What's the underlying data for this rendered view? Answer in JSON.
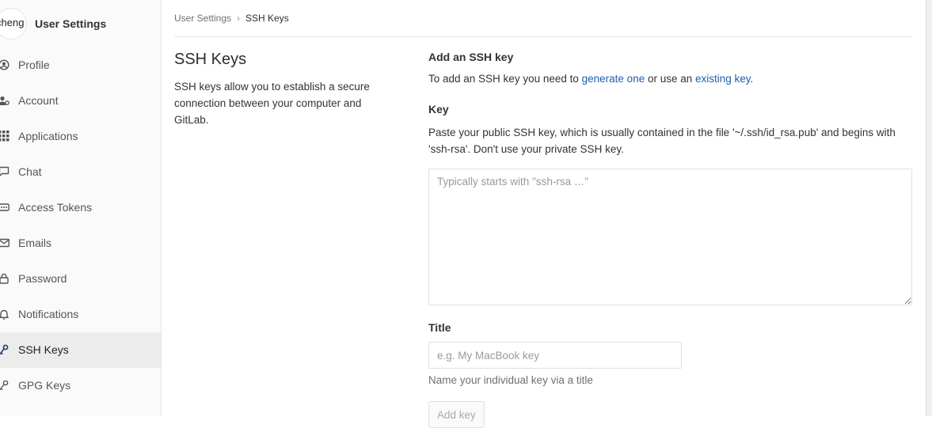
{
  "sidebar": {
    "avatar_text": "cheng",
    "title": "User Settings",
    "items": [
      {
        "label": "Profile",
        "icon": "profile-icon"
      },
      {
        "label": "Account",
        "icon": "account-icon"
      },
      {
        "label": "Applications",
        "icon": "applications-icon"
      },
      {
        "label": "Chat",
        "icon": "chat-icon"
      },
      {
        "label": "Access Tokens",
        "icon": "access-tokens-icon"
      },
      {
        "label": "Emails",
        "icon": "email-icon"
      },
      {
        "label": "Password",
        "icon": "lock-icon"
      },
      {
        "label": "Notifications",
        "icon": "bell-icon"
      },
      {
        "label": "SSH Keys",
        "icon": "key-icon",
        "active": true
      },
      {
        "label": "GPG Keys",
        "icon": "key-icon"
      }
    ]
  },
  "breadcrumb": {
    "parent": "User Settings",
    "separator": "›",
    "current": "SSH Keys"
  },
  "page": {
    "title": "SSH Keys",
    "description": "SSH keys allow you to establish a secure connection between your computer and GitLab."
  },
  "form": {
    "heading": "Add an SSH key",
    "intro_prefix": "To add an SSH key you need to ",
    "generate_link": "generate one",
    "intro_middle": " or use an ",
    "existing_link": "existing key",
    "intro_suffix": ".",
    "key_label": "Key",
    "key_help": "Paste your public SSH key, which is usually contained in the file '~/.ssh/id_rsa.pub' and begins with 'ssh-rsa'. Don't use your private SSH key.",
    "key_placeholder": "Typically starts with \"ssh-rsa …\"",
    "title_label": "Title",
    "title_placeholder": "e.g. My MacBook key",
    "title_help": "Name your individual key via a title",
    "submit_label": "Add key"
  },
  "colors": {
    "link": "#1f5eae",
    "sidebar_bg": "#fafafa",
    "active_item_bg": "#ececec"
  }
}
